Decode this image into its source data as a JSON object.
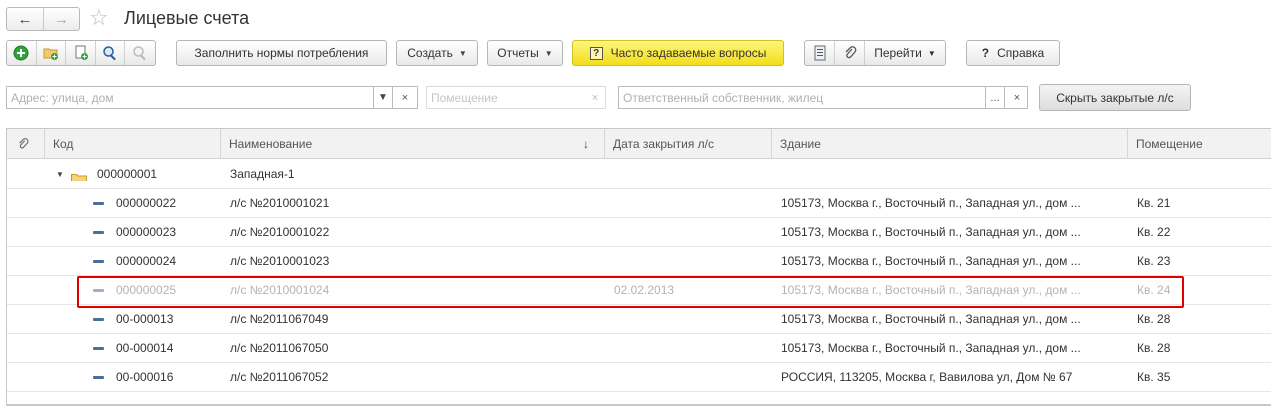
{
  "window": {
    "title": "Лицевые счета",
    "back_icon": "arrow-left-icon",
    "forward_icon": "arrow-right-icon",
    "favorite_icon": "star-icon"
  },
  "toolbar": {
    "fill_norms_label": "Заполнить нормы потребления",
    "create_label": "Создать",
    "reports_label": "Отчеты",
    "faq_label": "Часто задаваемые вопросы",
    "faq_icon": "?",
    "goto_label": "Перейти",
    "help_label": "Справка",
    "help_icon": "?"
  },
  "filters": {
    "address_placeholder": "Адрес: улица, дом",
    "premises_placeholder": "Помещение",
    "owner_placeholder": "Ответственный собственник, жилец",
    "hide_closed_label": "Скрыть закрытые л/с",
    "ellipsis": "...",
    "clear": "×"
  },
  "table": {
    "columns": {
      "code": "Код",
      "name": "Наименование",
      "sort_indicator": "↓",
      "close_date": "Дата закрытия л/с",
      "building": "Здание",
      "premises": "Помещение"
    },
    "group": {
      "expand_icon": "▼",
      "code": "000000001",
      "name": "Западная-1"
    },
    "rows": [
      {
        "code": "000000022",
        "name": "л/с №2010001021",
        "close_date": "",
        "building": "105173, Москва г., Восточный п., Западная ул., дом ...",
        "premises": "Кв. 21",
        "closed": false
      },
      {
        "code": "000000023",
        "name": "л/с №2010001022",
        "close_date": "",
        "building": "105173, Москва г., Восточный п., Западная ул., дом ...",
        "premises": "Кв. 22",
        "closed": false
      },
      {
        "code": "000000024",
        "name": "л/с №2010001023",
        "close_date": "",
        "building": "105173, Москва г., Восточный п., Западная ул., дом ...",
        "premises": "Кв. 23",
        "closed": false
      },
      {
        "code": "000000025",
        "name": "л/с №2010001024",
        "close_date": "02.02.2013",
        "building": "105173, Москва г., Восточный п., Западная ул., дом ...",
        "premises": "Кв. 24",
        "closed": true
      },
      {
        "code": "00-000013",
        "name": "л/с №2011067049",
        "close_date": "",
        "building": "105173, Москва г., Восточный п., Западная ул., дом ...",
        "premises": "Кв. 28",
        "closed": false
      },
      {
        "code": "00-000014",
        "name": "л/с №2011067050",
        "close_date": "",
        "building": "105173, Москва г., Восточный п., Западная ул., дом ...",
        "premises": "Кв. 28",
        "closed": false
      },
      {
        "code": "00-000016",
        "name": "л/с №2011067052",
        "close_date": "",
        "building": "РОССИЯ, 113205, Москва г, Вавилова ул, Дом № 67",
        "premises": "Кв. 35",
        "closed": false
      }
    ]
  },
  "colors": {
    "highlight": "#e00000",
    "faq_button": "#f7e437",
    "closed_text": "#b3b3b3"
  }
}
